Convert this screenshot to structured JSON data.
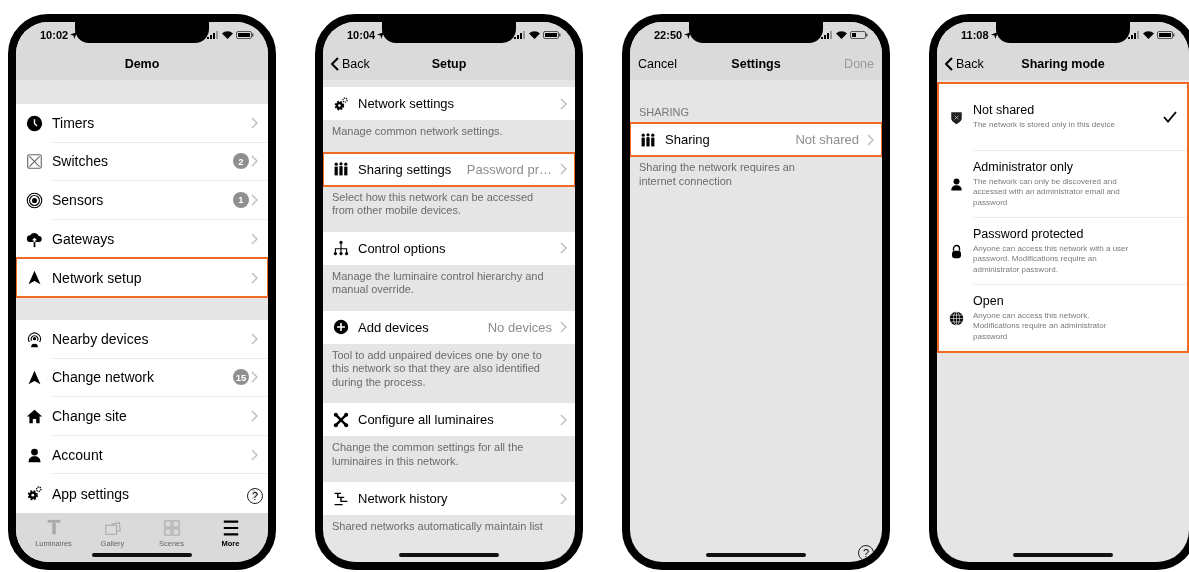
{
  "screens": [
    {
      "kind": "menu",
      "status_bar": {
        "time": "10:02"
      },
      "nav": {
        "title": "Demo"
      },
      "sections": [
        {
          "rows": [
            {
              "label": "Timers",
              "highlighted": false
            },
            {
              "label": "Switches",
              "badge": "2",
              "highlighted": false
            },
            {
              "label": "Sensors",
              "badge": "1",
              "highlighted": false
            },
            {
              "label": "Gateways",
              "highlighted": false
            },
            {
              "label": "Network setup",
              "highlighted": true
            }
          ]
        },
        {
          "rows": [
            {
              "label": "Nearby devices",
              "highlighted": false
            },
            {
              "label": "Change network",
              "badge": "15",
              "highlighted": false
            },
            {
              "label": "Change site",
              "highlighted": false
            },
            {
              "label": "Account",
              "highlighted": false
            },
            {
              "label": "App settings",
              "highlighted": false
            }
          ]
        }
      ],
      "help": "?",
      "tab_bar": [
        {
          "label": "Luminaires",
          "selected": false
        },
        {
          "label": "Gallery",
          "selected": false
        },
        {
          "label": "Scenes",
          "selected": false
        },
        {
          "label": "More",
          "selected": true
        }
      ]
    },
    {
      "kind": "settings",
      "status_bar": {
        "time": "10:04"
      },
      "nav": {
        "back": "Back",
        "title": "Setup"
      },
      "groups": [
        {
          "label": "Network settings",
          "highlighted": false,
          "footer": "Manage common network settings."
        },
        {
          "label": "Sharing settings",
          "value": "Password pr…",
          "highlighted": true,
          "footer": "Select how this network can be accessed from other mobile devices."
        },
        {
          "label": "Control options",
          "highlighted": false,
          "footer": "Manage the luminaire control hierarchy and manual override."
        },
        {
          "label": "Add devices",
          "value": "No devices",
          "highlighted": false,
          "footer": "Tool to add unpaired devices one by one to this network so that they are also identified during the process."
        },
        {
          "label": "Configure all luminaires",
          "highlighted": false,
          "footer": "Change the common settings for all the luminaires in this network."
        },
        {
          "label": "Network history",
          "highlighted": false,
          "footer": "Shared networks automatically maintain list"
        }
      ]
    },
    {
      "kind": "settings",
      "status_bar": {
        "time": "22:50"
      },
      "nav": {
        "left": "Cancel",
        "title": "Settings",
        "right": "Done",
        "right_disabled": true
      },
      "section_header": "SHARING",
      "groups": [
        {
          "label": "Sharing",
          "value": "Not shared",
          "highlighted": true,
          "footer": "Sharing the network requires an internet connection"
        }
      ],
      "help": "?"
    },
    {
      "kind": "options",
      "status_bar": {
        "time": "11:08"
      },
      "nav": {
        "back": "Back",
        "title": "Sharing mode"
      },
      "highlighted": true,
      "options": [
        {
          "title": "Not shared",
          "description": "The network is stored only in this device",
          "selected": true
        },
        {
          "title": "Administrator only",
          "description": "The network can only be discovered and accessed with an administrator email and password",
          "selected": false
        },
        {
          "title": "Password protected",
          "description": "Anyone can access this network with a user password. Modifications require an administrator password.",
          "selected": false
        },
        {
          "title": "Open",
          "description": "Anyone can access this network. Modifications require an administrator password",
          "selected": false
        }
      ]
    }
  ]
}
